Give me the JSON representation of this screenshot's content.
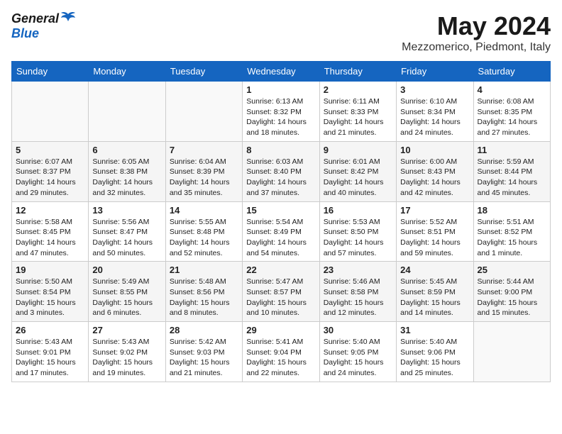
{
  "logo": {
    "general": "General",
    "blue": "Blue"
  },
  "title": "May 2024",
  "location": "Mezzomerico, Piedmont, Italy",
  "days_header": [
    "Sunday",
    "Monday",
    "Tuesday",
    "Wednesday",
    "Thursday",
    "Friday",
    "Saturday"
  ],
  "weeks": [
    [
      {
        "day": "",
        "info": ""
      },
      {
        "day": "",
        "info": ""
      },
      {
        "day": "",
        "info": ""
      },
      {
        "day": "1",
        "info": "Sunrise: 6:13 AM\nSunset: 8:32 PM\nDaylight: 14 hours and 18 minutes."
      },
      {
        "day": "2",
        "info": "Sunrise: 6:11 AM\nSunset: 8:33 PM\nDaylight: 14 hours and 21 minutes."
      },
      {
        "day": "3",
        "info": "Sunrise: 6:10 AM\nSunset: 8:34 PM\nDaylight: 14 hours and 24 minutes."
      },
      {
        "day": "4",
        "info": "Sunrise: 6:08 AM\nSunset: 8:35 PM\nDaylight: 14 hours and 27 minutes."
      }
    ],
    [
      {
        "day": "5",
        "info": "Sunrise: 6:07 AM\nSunset: 8:37 PM\nDaylight: 14 hours and 29 minutes."
      },
      {
        "day": "6",
        "info": "Sunrise: 6:05 AM\nSunset: 8:38 PM\nDaylight: 14 hours and 32 minutes."
      },
      {
        "day": "7",
        "info": "Sunrise: 6:04 AM\nSunset: 8:39 PM\nDaylight: 14 hours and 35 minutes."
      },
      {
        "day": "8",
        "info": "Sunrise: 6:03 AM\nSunset: 8:40 PM\nDaylight: 14 hours and 37 minutes."
      },
      {
        "day": "9",
        "info": "Sunrise: 6:01 AM\nSunset: 8:42 PM\nDaylight: 14 hours and 40 minutes."
      },
      {
        "day": "10",
        "info": "Sunrise: 6:00 AM\nSunset: 8:43 PM\nDaylight: 14 hours and 42 minutes."
      },
      {
        "day": "11",
        "info": "Sunrise: 5:59 AM\nSunset: 8:44 PM\nDaylight: 14 hours and 45 minutes."
      }
    ],
    [
      {
        "day": "12",
        "info": "Sunrise: 5:58 AM\nSunset: 8:45 PM\nDaylight: 14 hours and 47 minutes."
      },
      {
        "day": "13",
        "info": "Sunrise: 5:56 AM\nSunset: 8:47 PM\nDaylight: 14 hours and 50 minutes."
      },
      {
        "day": "14",
        "info": "Sunrise: 5:55 AM\nSunset: 8:48 PM\nDaylight: 14 hours and 52 minutes."
      },
      {
        "day": "15",
        "info": "Sunrise: 5:54 AM\nSunset: 8:49 PM\nDaylight: 14 hours and 54 minutes."
      },
      {
        "day": "16",
        "info": "Sunrise: 5:53 AM\nSunset: 8:50 PM\nDaylight: 14 hours and 57 minutes."
      },
      {
        "day": "17",
        "info": "Sunrise: 5:52 AM\nSunset: 8:51 PM\nDaylight: 14 hours and 59 minutes."
      },
      {
        "day": "18",
        "info": "Sunrise: 5:51 AM\nSunset: 8:52 PM\nDaylight: 15 hours and 1 minute."
      }
    ],
    [
      {
        "day": "19",
        "info": "Sunrise: 5:50 AM\nSunset: 8:54 PM\nDaylight: 15 hours and 3 minutes."
      },
      {
        "day": "20",
        "info": "Sunrise: 5:49 AM\nSunset: 8:55 PM\nDaylight: 15 hours and 6 minutes."
      },
      {
        "day": "21",
        "info": "Sunrise: 5:48 AM\nSunset: 8:56 PM\nDaylight: 15 hours and 8 minutes."
      },
      {
        "day": "22",
        "info": "Sunrise: 5:47 AM\nSunset: 8:57 PM\nDaylight: 15 hours and 10 minutes."
      },
      {
        "day": "23",
        "info": "Sunrise: 5:46 AM\nSunset: 8:58 PM\nDaylight: 15 hours and 12 minutes."
      },
      {
        "day": "24",
        "info": "Sunrise: 5:45 AM\nSunset: 8:59 PM\nDaylight: 15 hours and 14 minutes."
      },
      {
        "day": "25",
        "info": "Sunrise: 5:44 AM\nSunset: 9:00 PM\nDaylight: 15 hours and 15 minutes."
      }
    ],
    [
      {
        "day": "26",
        "info": "Sunrise: 5:43 AM\nSunset: 9:01 PM\nDaylight: 15 hours and 17 minutes."
      },
      {
        "day": "27",
        "info": "Sunrise: 5:43 AM\nSunset: 9:02 PM\nDaylight: 15 hours and 19 minutes."
      },
      {
        "day": "28",
        "info": "Sunrise: 5:42 AM\nSunset: 9:03 PM\nDaylight: 15 hours and 21 minutes."
      },
      {
        "day": "29",
        "info": "Sunrise: 5:41 AM\nSunset: 9:04 PM\nDaylight: 15 hours and 22 minutes."
      },
      {
        "day": "30",
        "info": "Sunrise: 5:40 AM\nSunset: 9:05 PM\nDaylight: 15 hours and 24 minutes."
      },
      {
        "day": "31",
        "info": "Sunrise: 5:40 AM\nSunset: 9:06 PM\nDaylight: 15 hours and 25 minutes."
      },
      {
        "day": "",
        "info": ""
      }
    ]
  ]
}
